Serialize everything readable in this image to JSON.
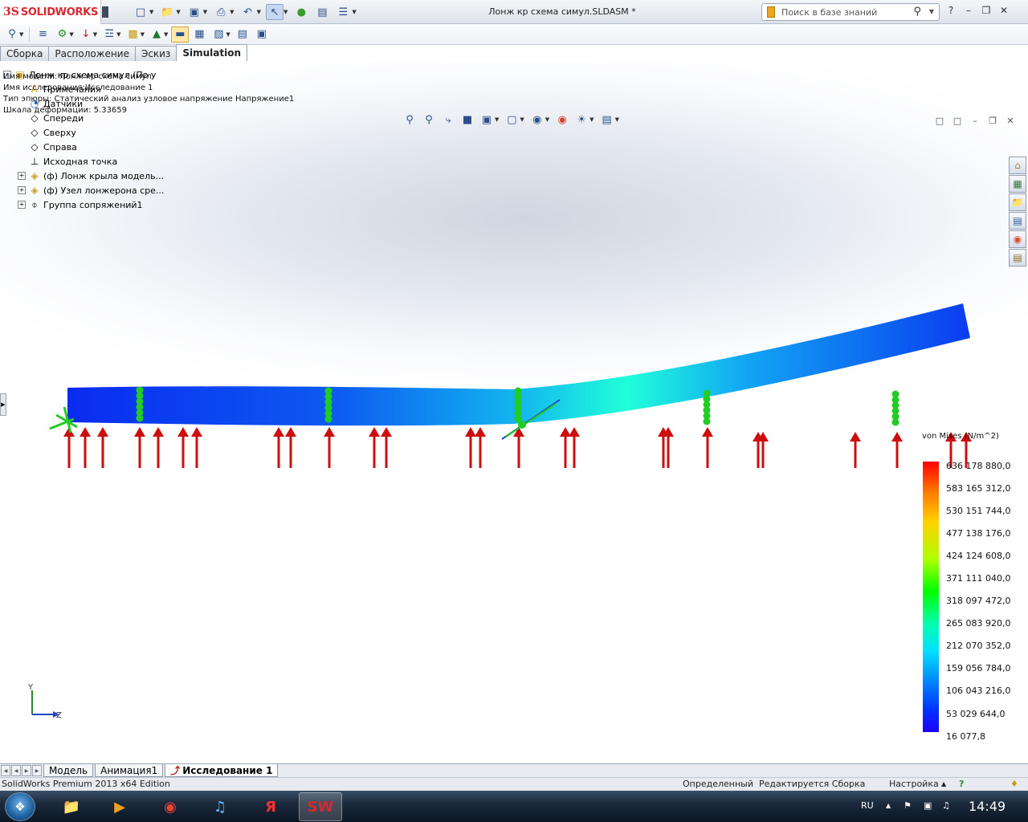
{
  "app": {
    "logo_ds": "3S",
    "logo_text": "SOLIDWORKS",
    "document_title": "Лонж кр схема симул.SLDASM *",
    "search_placeholder": "Поиск в базе знаний",
    "help_icon": "?"
  },
  "command_tabs": [
    {
      "label": "Сборка"
    },
    {
      "label": "Расположение"
    },
    {
      "label": "Эскиз"
    },
    {
      "label": "Simulation"
    }
  ],
  "feature_tree": {
    "items": [
      {
        "label": "Лонж кр схема симул  (По у"
      },
      {
        "label": "Примечания"
      },
      {
        "label": "Датчики"
      },
      {
        "label": "Спереди"
      },
      {
        "label": "Сверху"
      },
      {
        "label": "Справа"
      },
      {
        "label": "Исходная точка"
      },
      {
        "label": "(ф) Лонж крыла модель..."
      },
      {
        "label": "(ф) Узел лонжерона сре..."
      },
      {
        "label": "Группа сопряжений1"
      }
    ]
  },
  "plot_info": {
    "line1": "Имя модели: Лонж кр схема симул",
    "line2": "Имя исследования:Исследование 1",
    "line3": "Тип эпюры: Статический анализ узловое напряжение Напряжение1",
    "line4": "Шкала деформации: 5.33659"
  },
  "legend": {
    "title": "von Mises (N/m^2)",
    "ticks": [
      "636 178 880,0",
      "583 165 312,0",
      "530 151 744,0",
      "477 138 176,0",
      "424 124 608,0",
      "371 111 040,0",
      "318 097 472,0",
      "265 083 920,0",
      "212 070 352,0",
      "159 056 784,0",
      "106 043 216,0",
      "53 029 644,0",
      "16 077,8"
    ]
  },
  "triad": {
    "y_label": "Y",
    "z_label": "Z"
  },
  "bottom_tabs": [
    {
      "label": "Модель"
    },
    {
      "label": "Анимация1"
    },
    {
      "label": "Исследование 1"
    }
  ],
  "status_bar": {
    "product": "SolidWorks Premium 2013 x64 Edition",
    "state": "Определенный",
    "mode": "Редактируется Сборка",
    "settings": "Настройка"
  },
  "taskbar": {
    "language": "RU",
    "time": "14:49"
  },
  "colors": {
    "load_arrow": "#cc0e0e",
    "fixture": "#22cc22",
    "accent": "#d8272f"
  }
}
